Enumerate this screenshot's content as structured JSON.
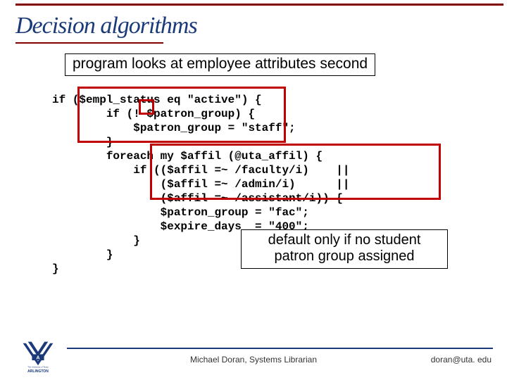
{
  "title": "Decision algorithms",
  "subtitle": "program looks at employee attributes second",
  "annotation": "default only if no student patron group assigned",
  "code": {
    "l1": "if ($empl_status eq \"active\") {",
    "l2": "        if (! $patron_group) {",
    "l3": "            $patron_group = \"staff\";",
    "l4": "        }",
    "l5": "        foreach my $affil (@uta_affil) {",
    "l6": "            if (($affil =~ /faculty/i)    ||",
    "l7": "                ($affil =~ /admin/i)      ||",
    "l8": "                ($affil =~ /assistant/i)) {",
    "l9": "                $patron_group = \"fac\";",
    "l10": "                $expire_days  = \"400\";",
    "l11": "            }",
    "l12": "        }",
    "l13": "}"
  },
  "footer": {
    "author": "Michael Doran, Systems Librarian",
    "email": "doran@uta. edu"
  },
  "logo": {
    "text_top": "The University of Texas",
    "text_bottom": "ARLINGTON"
  },
  "colors": {
    "accent_dark_red": "#800000",
    "accent_red": "#c00000",
    "title_blue": "#1a3a7a"
  }
}
